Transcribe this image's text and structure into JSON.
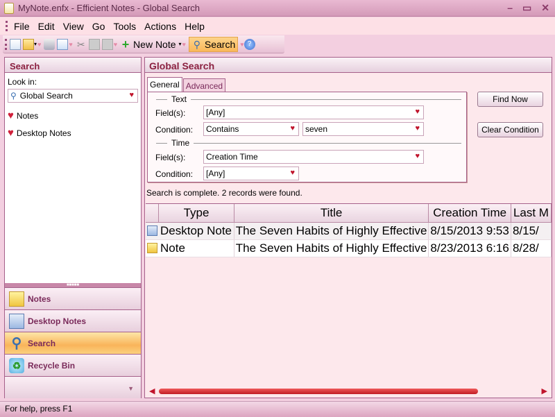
{
  "window": {
    "title": "MyNote.enfx - Efficient Notes - Global Search",
    "controls": [
      "minimize",
      "maximize",
      "close"
    ]
  },
  "menu": [
    {
      "label": "File",
      "accel": "F"
    },
    {
      "label": "Edit",
      "accel": "E"
    },
    {
      "label": "View",
      "accel": "V"
    },
    {
      "label": "Go",
      "accel": "G"
    },
    {
      "label": "Tools",
      "accel": "T"
    },
    {
      "label": "Actions",
      "accel": "A"
    },
    {
      "label": "Help",
      "accel": "H"
    }
  ],
  "toolbar": {
    "new_note_label": "New Note",
    "search_label": "Search",
    "icons": [
      "new-document-icon",
      "open-folder-icon",
      "print-icon",
      "print-preview-icon",
      "cut-icon",
      "copy-icon",
      "paste-icon",
      "plus-icon",
      "search-icon",
      "help-icon"
    ]
  },
  "left": {
    "header": "Search",
    "look_in_label": "Look in:",
    "look_in_value": "Global Search",
    "folders": [
      "Notes",
      "Desktop Notes"
    ],
    "nav": [
      {
        "label": "Notes",
        "icon": "notes-icon",
        "active": false
      },
      {
        "label": "Desktop Notes",
        "icon": "desktop-notes-icon",
        "active": false
      },
      {
        "label": "Search",
        "icon": "search-icon",
        "active": true
      },
      {
        "label": "Recycle Bin",
        "icon": "recycle-bin-icon",
        "active": false
      }
    ]
  },
  "right": {
    "header": "Global Search",
    "tabs": [
      "General",
      "Advanced"
    ],
    "active_tab": "General",
    "text_group": "Text",
    "time_group": "Time",
    "fields_label": "Field(s):",
    "condition_label": "Condition:",
    "text_fields_value": "[Any]",
    "text_condition_value": "Contains",
    "text_keyword_value": "seven",
    "time_fields_value": "Creation Time",
    "time_condition_value": "[Any]",
    "find_now": "Find Now",
    "clear_condition": "Clear Condition",
    "status": "Search is complete. 2 records were found."
  },
  "results": {
    "columns": [
      "",
      "Type",
      "Title",
      "Creation Time",
      "Last M"
    ],
    "rows": [
      {
        "icon": "desktop-note-icon",
        "type": "Desktop Note",
        "title": "The Seven Habits of Highly Effective",
        "created": "8/15/2013 9:53",
        "modified": "8/15/"
      },
      {
        "icon": "note-icon",
        "type": "Note",
        "title": "The Seven Habits of Highly Effective",
        "created": "8/23/2013 6:16",
        "modified": "8/28/"
      }
    ]
  },
  "statusbar": {
    "text": "For help, press F1"
  }
}
